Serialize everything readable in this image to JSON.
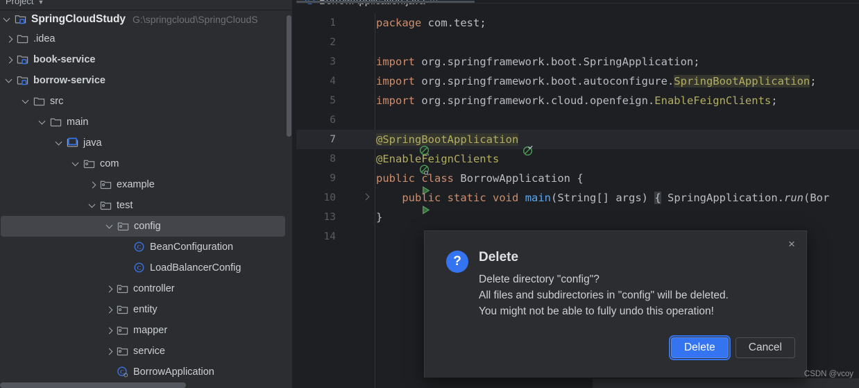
{
  "toolwindow": {
    "title": "Project",
    "collapse_icon": "chevron-down-icon"
  },
  "tree": {
    "root": {
      "label": "SpringCloudStudy",
      "path": "G:\\springcloud\\SpringCloudS"
    },
    "items": [
      {
        "label": ".idea",
        "icon": "folder-icon",
        "arrow": "right",
        "indent": 24,
        "selected": false
      },
      {
        "label": "book-service",
        "icon": "module-icon",
        "arrow": "right",
        "indent": 24,
        "selected": false,
        "bold": true
      },
      {
        "label": "borrow-service",
        "icon": "module-icon",
        "arrow": "down",
        "indent": 24,
        "selected": false,
        "bold": true
      },
      {
        "label": "src",
        "icon": "folder-icon",
        "arrow": "down",
        "indent": 48,
        "selected": false
      },
      {
        "label": "main",
        "icon": "folder-icon",
        "arrow": "down",
        "indent": 72,
        "selected": false
      },
      {
        "label": "java",
        "icon": "source-root-icon",
        "arrow": "down",
        "indent": 96,
        "selected": false
      },
      {
        "label": "com",
        "icon": "package-icon",
        "arrow": "down",
        "indent": 120,
        "selected": false
      },
      {
        "label": "example",
        "icon": "package-icon",
        "arrow": "right",
        "indent": 144,
        "selected": false
      },
      {
        "label": "test",
        "icon": "package-icon",
        "arrow": "down",
        "indent": 144,
        "selected": false
      },
      {
        "label": "config",
        "icon": "package-icon",
        "arrow": "down",
        "indent": 168,
        "selected": true
      },
      {
        "label": "BeanConfiguration",
        "icon": "class-icon",
        "arrow": "none",
        "indent": 192,
        "selected": false
      },
      {
        "label": "LoadBalancerConfig",
        "icon": "class-icon",
        "arrow": "none",
        "indent": 192,
        "selected": false
      },
      {
        "label": "controller",
        "icon": "package-icon",
        "arrow": "right",
        "indent": 168,
        "selected": false
      },
      {
        "label": "entity",
        "icon": "package-icon",
        "arrow": "right",
        "indent": 168,
        "selected": false
      },
      {
        "label": "mapper",
        "icon": "package-icon",
        "arrow": "right",
        "indent": 168,
        "selected": false
      },
      {
        "label": "service",
        "icon": "package-icon",
        "arrow": "right",
        "indent": 168,
        "selected": false
      },
      {
        "label": "BorrowApplication",
        "icon": "spring-class-icon",
        "arrow": "none",
        "indent": 168,
        "selected": false
      }
    ]
  },
  "editor": {
    "tab": {
      "label": "BorrowApplication.java",
      "icon": "spring-class-icon",
      "more_icon": "more-ellipsis-icon"
    },
    "lines": [
      {
        "num": "1",
        "current": false,
        "gutter": [],
        "fold": false
      },
      {
        "num": "2",
        "current": false,
        "gutter": [],
        "fold": false
      },
      {
        "num": "3",
        "current": false,
        "gutter": [],
        "fold": false
      },
      {
        "num": "4",
        "current": false,
        "gutter": [],
        "fold": false
      },
      {
        "num": "5",
        "current": false,
        "gutter": [],
        "fold": false
      },
      {
        "num": "6",
        "current": false,
        "gutter": [],
        "fold": false
      },
      {
        "num": "7",
        "current": true,
        "gutter": [
          "bean-icon",
          "bean-check-icon"
        ],
        "fold": false
      },
      {
        "num": "8",
        "current": false,
        "gutter": [
          "bean-search-icon"
        ],
        "fold": false
      },
      {
        "num": "9",
        "current": false,
        "gutter": [
          "run-icon"
        ],
        "fold": false
      },
      {
        "num": "10",
        "current": false,
        "gutter": [
          "run-icon"
        ],
        "fold": true
      },
      {
        "num": "13",
        "current": false,
        "gutter": [],
        "fold": false
      },
      {
        "num": "14",
        "current": false,
        "gutter": [],
        "fold": false
      }
    ],
    "code": {
      "l1_kw": "package",
      "l1_rest": " com.test;",
      "l3_kw": "import",
      "l3_rest": " org.springframework.boot.SpringApplication;",
      "l4_kw": "import",
      "l4_a": " org.springframework.boot.autoconfigure.",
      "l4_hl": "SpringBootApplication",
      "l4_b": ";",
      "l5_kw": "import",
      "l5_a": " org.springframework.cloud.openfeign.",
      "l5_b": "EnableFeignClients",
      "l5_c": ";",
      "l7_at": "@",
      "l7_ann": "SpringBootApplication",
      "l8_ann": "@EnableFeignClients",
      "l9_kw1": "public",
      "l9_kw2": "class",
      "l9_name": "BorrowApplication",
      "l9_brace": "{",
      "l10_indent": "    ",
      "l10_kw1": "public",
      "l10_kw2": "static",
      "l10_kw3": "void",
      "l10_method": "main",
      "l10_params": "(String[] args)",
      "l10_brace": "{",
      "l10_call_a": " SpringApplication.",
      "l10_call_b": "run",
      "l10_call_c": "(Bor",
      "l13_brace": "}"
    }
  },
  "dialog": {
    "title": "Delete",
    "icon": "question-icon",
    "icon_glyph": "?",
    "close_icon": "close-icon",
    "close_glyph": "×",
    "message_lines": [
      "Delete directory \"config\"?",
      "All files and subdirectories in \"config\" will be deleted.",
      "You might not be able to fully undo this operation!"
    ],
    "buttons": {
      "confirm": "Delete",
      "cancel": "Cancel"
    },
    "accent_color": "#3574f0"
  },
  "watermark": "CSDN @vcoy"
}
